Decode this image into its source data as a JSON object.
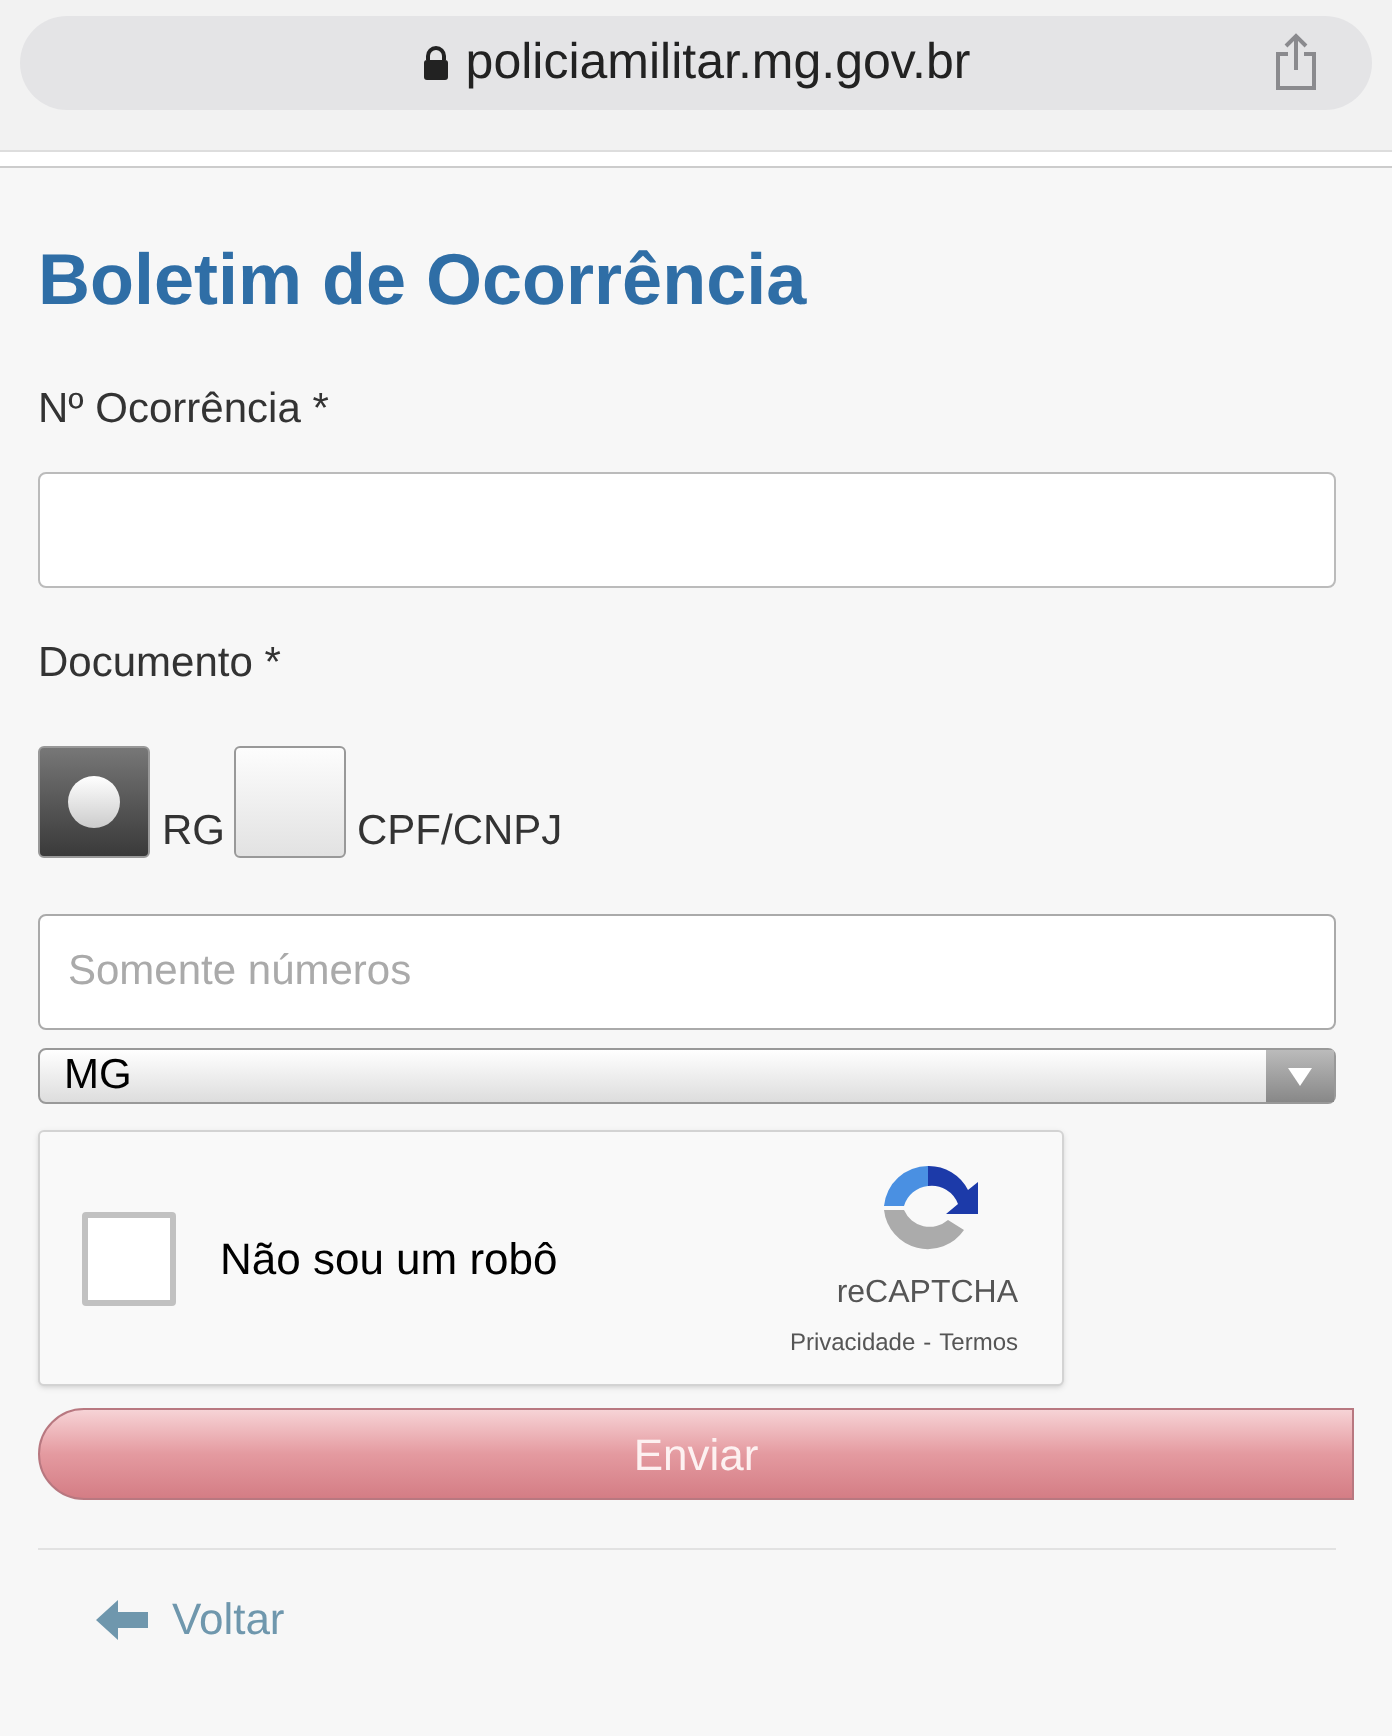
{
  "browser": {
    "url": "policiamilitar.mg.gov.br"
  },
  "page_title": "Boletim de Ocorrência",
  "occurrence_field": {
    "label": "Nº Ocorrência *"
  },
  "document": {
    "label": "Documento *",
    "options": [
      {
        "label": "RG",
        "selected": true
      },
      {
        "label": "CPF/CNPJ",
        "selected": false
      }
    ]
  },
  "number_field": {
    "placeholder": "Somente números"
  },
  "state_select": {
    "value": "MG"
  },
  "captcha": {
    "label": "Não sou um robô",
    "checked": false,
    "brand": "reCAPTCHA",
    "privacy": "Privacidade",
    "separator": "-",
    "terms": "Termos"
  },
  "submit_button": "Enviar",
  "back_link": "Voltar"
}
